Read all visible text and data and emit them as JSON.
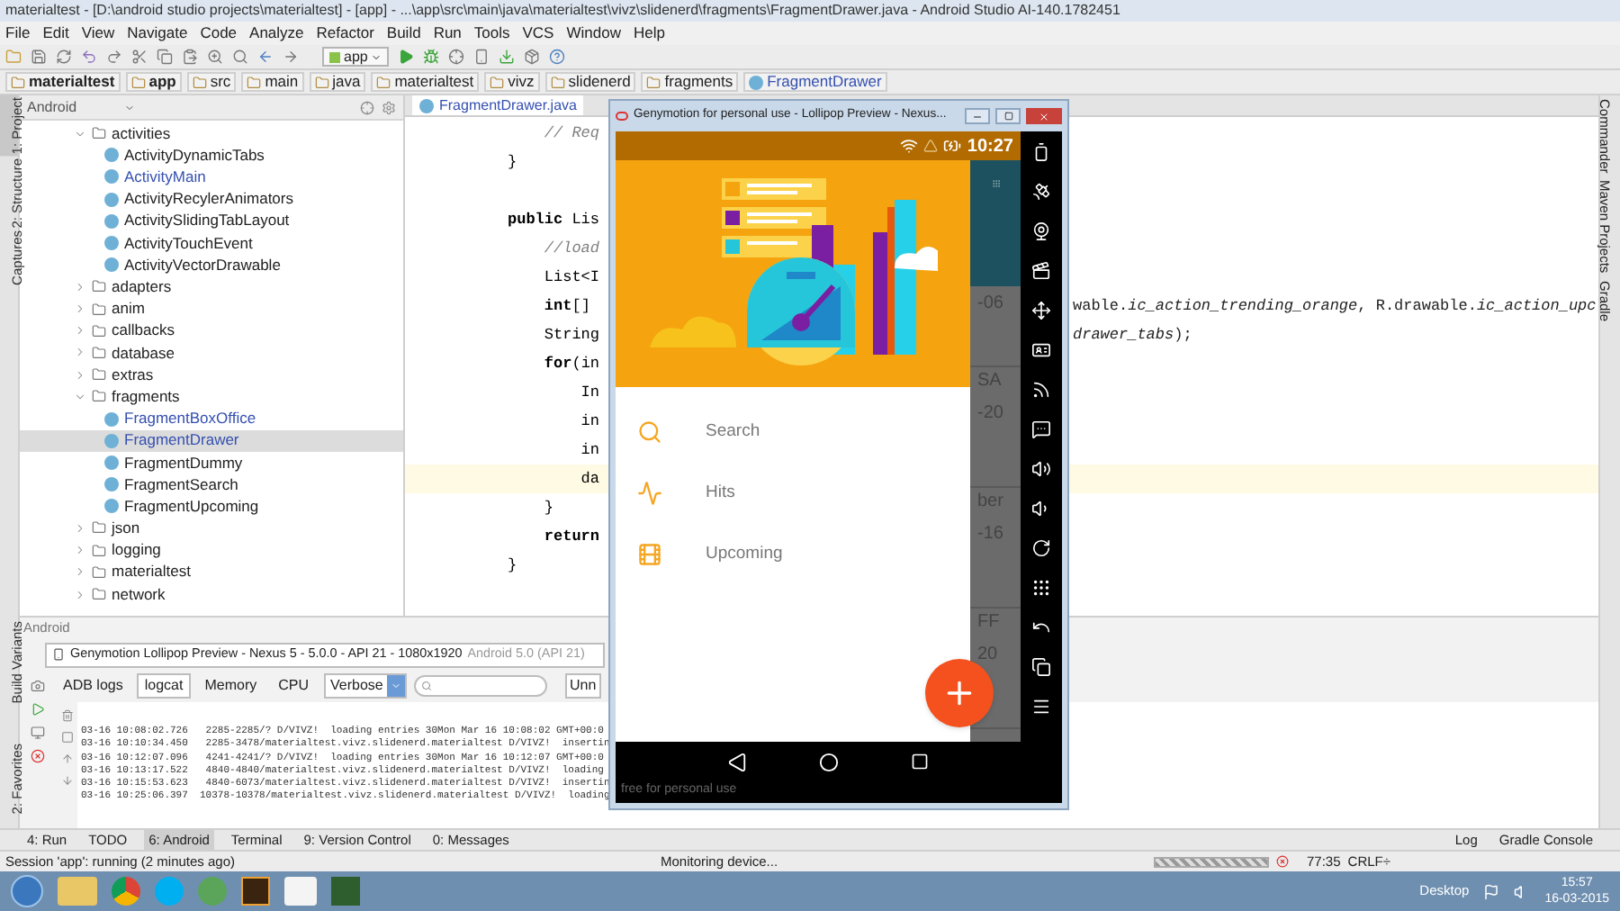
{
  "window": {
    "title": "materialtest - [D:\\android studio projects\\materialtest] - [app] - ...\\app\\src\\main\\java\\materialtest\\vivz\\slidenerd\\fragments\\FragmentDrawer.java - Android Studio AI-140.1782451"
  },
  "menu": [
    "File",
    "Edit",
    "View",
    "Navigate",
    "Code",
    "Analyze",
    "Refactor",
    "Build",
    "Run",
    "Tools",
    "VCS",
    "Window",
    "Help"
  ],
  "toolbar": {
    "run_config": "app"
  },
  "breadcrumbs": [
    {
      "label": "materialtest",
      "kind": "module"
    },
    {
      "label": "app",
      "kind": "module"
    },
    {
      "label": "src",
      "kind": "folder"
    },
    {
      "label": "main",
      "kind": "folder"
    },
    {
      "label": "java",
      "kind": "folder"
    },
    {
      "label": "materialtest",
      "kind": "folder"
    },
    {
      "label": "vivz",
      "kind": "folder"
    },
    {
      "label": "slidenerd",
      "kind": "folder"
    },
    {
      "label": "fragments",
      "kind": "folder"
    },
    {
      "label": "FragmentDrawer",
      "kind": "class"
    }
  ],
  "left_tool_strip": {
    "top": [
      {
        "label": "1: Project",
        "selected": true
      },
      {
        "label": "2: Structure",
        "selected": false
      },
      {
        "label": "Captures",
        "selected": false
      }
    ],
    "bottom": [
      {
        "label": "Build Variants",
        "selected": false
      },
      {
        "label": "2: Favorites",
        "selected": false
      }
    ]
  },
  "right_tool_strip": [
    "Commander",
    "Maven Projects",
    "Gradle"
  ],
  "project": {
    "view": "Android",
    "tree": [
      {
        "label": "activities",
        "kind": "folder",
        "expanded": true,
        "selected": false,
        "children": [
          {
            "label": "ActivityDynamicTabs",
            "kind": "class",
            "modified": false,
            "selected": false
          },
          {
            "label": "ActivityMain",
            "kind": "class",
            "modified": true,
            "selected": false
          },
          {
            "label": "ActivityRecylerAnimators",
            "kind": "class",
            "modified": false,
            "selected": false
          },
          {
            "label": "ActivitySlidingTabLayout",
            "kind": "class",
            "modified": false,
            "selected": false
          },
          {
            "label": "ActivityTouchEvent",
            "kind": "class",
            "modified": false,
            "selected": false
          },
          {
            "label": "ActivityVectorDrawable",
            "kind": "class",
            "modified": false,
            "selected": false
          }
        ]
      },
      {
        "label": "adapters",
        "kind": "folder",
        "expanded": false,
        "selected": false
      },
      {
        "label": "anim",
        "kind": "folder",
        "expanded": false,
        "selected": false
      },
      {
        "label": "callbacks",
        "kind": "folder",
        "expanded": false,
        "selected": false
      },
      {
        "label": "database",
        "kind": "folder",
        "expanded": false,
        "selected": false
      },
      {
        "label": "extras",
        "kind": "folder",
        "expanded": false,
        "selected": false
      },
      {
        "label": "fragments",
        "kind": "folder",
        "expanded": true,
        "selected": false,
        "children": [
          {
            "label": "FragmentBoxOffice",
            "kind": "class",
            "modified": true,
            "selected": false
          },
          {
            "label": "FragmentDrawer",
            "kind": "class",
            "modified": true,
            "selected": true
          },
          {
            "label": "FragmentDummy",
            "kind": "class",
            "modified": false,
            "selected": false
          },
          {
            "label": "FragmentSearch",
            "kind": "class",
            "modified": false,
            "selected": false
          },
          {
            "label": "FragmentUpcoming",
            "kind": "class",
            "modified": false,
            "selected": false
          }
        ]
      },
      {
        "label": "json",
        "kind": "folder",
        "expanded": false,
        "selected": false
      },
      {
        "label": "logging",
        "kind": "folder",
        "expanded": false,
        "selected": false
      },
      {
        "label": "materialtest",
        "kind": "folder",
        "expanded": false,
        "selected": false
      },
      {
        "label": "network",
        "kind": "folder",
        "expanded": false,
        "selected": false
      }
    ]
  },
  "editor": {
    "tab": "FragmentDrawer.java",
    "lines": [
      {
        "kind": "comment",
        "left": "    // Req",
        "current": false
      },
      {
        "kind": "code",
        "left": "}",
        "current": false
      },
      {
        "kind": "blank",
        "current": false
      },
      {
        "kind": "code",
        "left": "**public** Lis",
        "current": false
      },
      {
        "kind": "comment",
        "left": "    //load",
        "current": false
      },
      {
        "kind": "code",
        "left": "    List<I",
        "current": false
      },
      {
        "kind": "code",
        "left": "    **int**[]",
        "right": "wable.*ic_action_trending_orange*, R.drawable.*ic_action_upc*",
        "current": false
      },
      {
        "kind": "code",
        "left": "    String",
        "right": "*drawer_tabs*);",
        "current": false
      },
      {
        "kind": "code",
        "left": "    **for**(in",
        "current": false
      },
      {
        "kind": "code",
        "left": "        In",
        "current": false
      },
      {
        "kind": "code",
        "left": "        in",
        "current": false
      },
      {
        "kind": "code",
        "left": "        in",
        "current": false
      },
      {
        "kind": "code",
        "left": "        da",
        "current": true
      },
      {
        "kind": "code",
        "left": "    }",
        "current": false
      },
      {
        "kind": "code",
        "left": "    **return**",
        "current": false
      },
      {
        "kind": "code",
        "left": "}",
        "current": false
      }
    ]
  },
  "android_panel": {
    "title": "Android",
    "device": "Genymotion Lollipop Preview - Nexus 5 - 5.0.0 - API 21 - 1080x1920",
    "device_version": "Android 5.0 (API 21)",
    "tabs": [
      {
        "label": "ADB logs",
        "selected": false
      },
      {
        "label": "logcat",
        "selected": true
      },
      {
        "label": "Memory",
        "selected": false
      },
      {
        "label": "CPU",
        "selected": false
      }
    ],
    "log_level": "Verbose",
    "filter": "Unn",
    "log_lines": [
      "03-16 10:08:02.726   2285-2285/? D/VIVZ!  loading entries 30Mon Mar 16 10:08:02 GMT+00:0",
      "03-16 10:10:34.450   2285-3478/materialtest.vivz.slidenerd.materialtest D/VIVZ!  insertin",
      "03-16 10:12:07.096   4241-4241/? D/VIVZ!  loading entries 30Mon Mar 16 10:12:07 GMT+00:0",
      "03-16 10:13:17.522   4840-4840/materialtest.vivz.slidenerd.materialtest D/VIVZ!  loading",
      "03-16 10:15:53.623   4840-6073/materialtest.vivz.slidenerd.materialtest D/VIVZ!  insertin",
      "03-16 10:25:06.397  10378-10378/materialtest.vivz.slidenerd.materialtest D/VIVZ!  loading"
    ]
  },
  "tool_windows": [
    {
      "label": "4: Run",
      "selected": false
    },
    {
      "label": "TODO",
      "selected": false
    },
    {
      "label": "6: Android",
      "selected": true
    },
    {
      "label": "Terminal",
      "selected": false
    },
    {
      "label": "9: Version Control",
      "selected": false
    },
    {
      "label": "0: Messages",
      "selected": false
    }
  ],
  "tool_windows_right": [
    "Log",
    "Gradle Console"
  ],
  "status_bar": {
    "message": "Session 'app': running (2 minutes ago)",
    "task": "Monitoring device...",
    "position": "77:35",
    "line_separator": "CRLF÷"
  },
  "emulator": {
    "title": "Genymotion for personal use - Lollipop Preview - Nexus...",
    "time": "10:27",
    "drawer_items": [
      {
        "label": "Search",
        "kind": "search"
      },
      {
        "label": "Hits",
        "kind": "hits"
      },
      {
        "label": "Upcoming",
        "kind": "upcoming"
      }
    ],
    "background_cards": [
      {
        "lines": [
          "-06"
        ]
      },
      {
        "lines": [
          "SA",
          "-20"
        ]
      },
      {
        "lines": [
          "ber",
          "-16"
        ]
      },
      {
        "lines": [
          "FF",
          "20"
        ]
      }
    ],
    "notice": "free for personal use"
  },
  "taskbar": {
    "desktop": "Desktop",
    "time": "15:57",
    "date": "16-03-2015"
  }
}
